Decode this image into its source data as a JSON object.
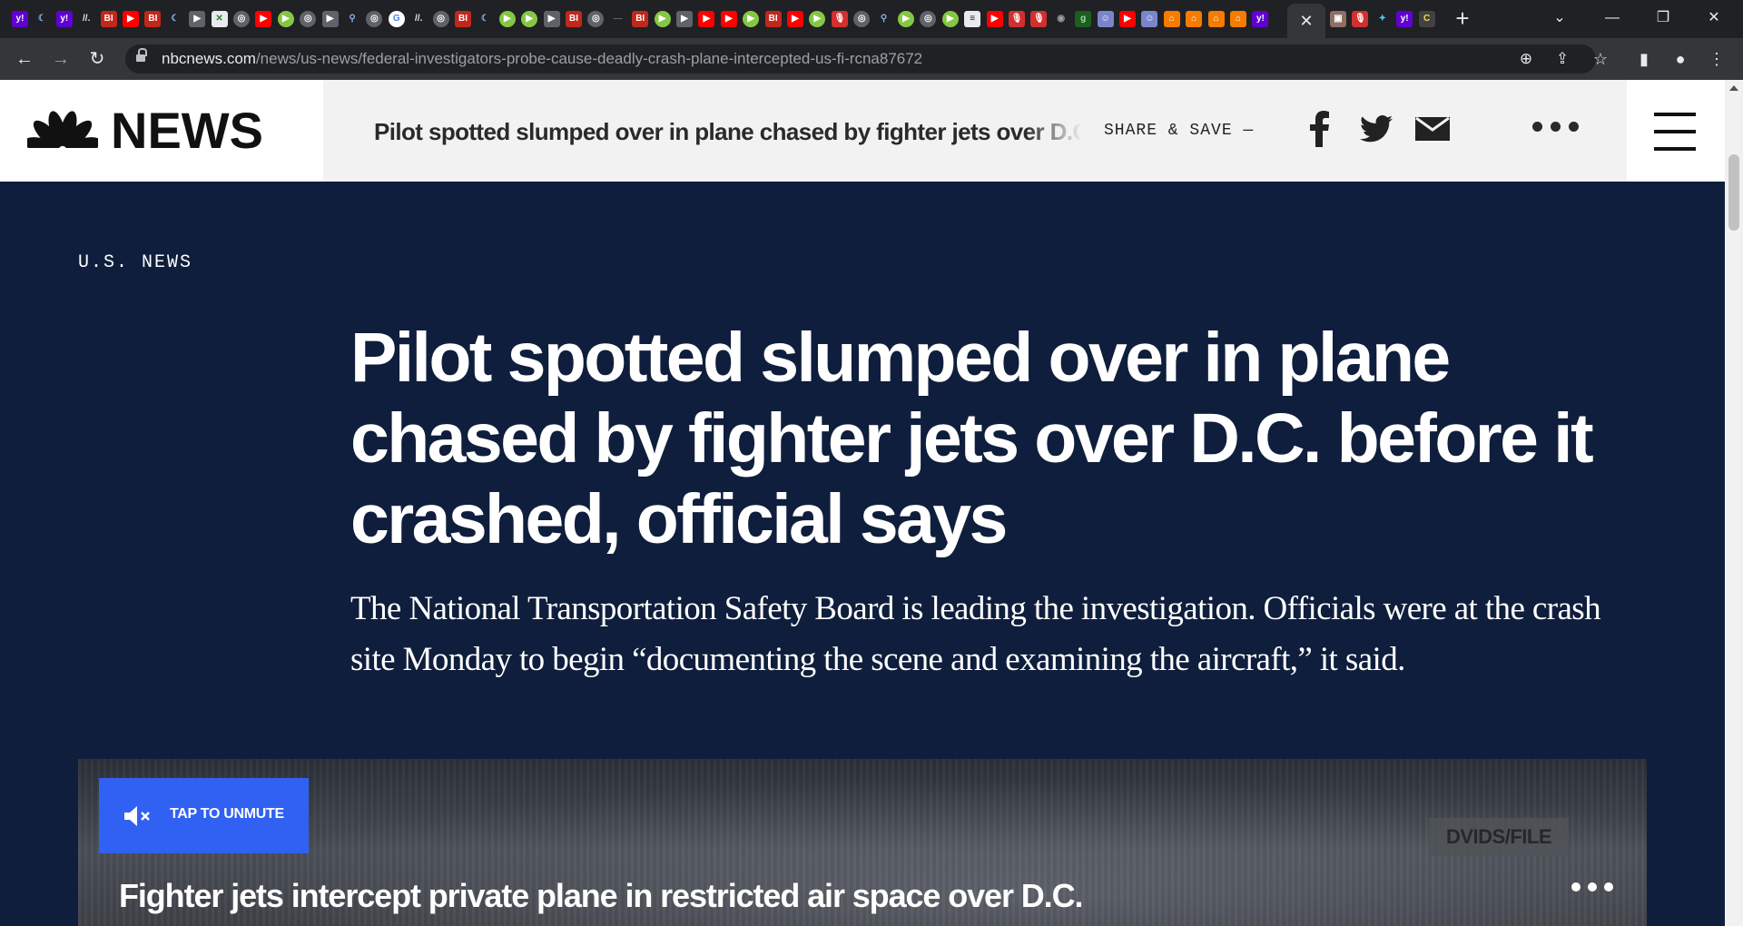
{
  "browser": {
    "favicons": [
      {
        "name": "yahoo-mail-icon",
        "bg": "#6001d2",
        "text": "y!"
      },
      {
        "name": "crescent-icon",
        "bg": "#202124",
        "text": "☾",
        "fg": "#8ab4f8"
      },
      {
        "name": "yahoo-mail-icon",
        "bg": "#6001d2",
        "text": "y!"
      },
      {
        "name": "slash-icon",
        "bg": "#202124",
        "text": "//.",
        "fg": "#e8eaed"
      },
      {
        "name": "business-insider-icon",
        "bg": "#c2271b",
        "text": "BI"
      },
      {
        "name": "youtube-icon",
        "bg": "#ff0000",
        "text": "▶"
      },
      {
        "name": "business-insider-icon",
        "bg": "#c2271b",
        "text": "BI"
      },
      {
        "name": "crescent-icon",
        "bg": "#202124",
        "text": "☾",
        "fg": "#8ab4f8"
      },
      {
        "name": "play-icon",
        "bg": "#5f6368",
        "text": "▶"
      },
      {
        "name": "puzzle-icon",
        "bg": "#e8eaed",
        "text": "✕",
        "fg": "#2e7d32"
      },
      {
        "name": "globe-icon",
        "bg": "#5f6368",
        "text": "◎",
        "circle": true
      },
      {
        "name": "youtube-icon",
        "bg": "#ff0000",
        "text": "▶"
      },
      {
        "name": "rumble-icon",
        "bg": "#85c742",
        "text": "▶",
        "circle": true
      },
      {
        "name": "globe-icon",
        "bg": "#5f6368",
        "text": "◎",
        "circle": true
      },
      {
        "name": "play-icon",
        "bg": "#5f6368",
        "text": "▶"
      },
      {
        "name": "search-icon",
        "bg": "#202124",
        "text": "⚲",
        "fg": "#8ab4f8"
      },
      {
        "name": "globe-icon",
        "bg": "#5f6368",
        "text": "◎",
        "circle": true
      },
      {
        "name": "google-icon",
        "bg": "#ffffff",
        "text": "G",
        "fg": "#4285f4",
        "circle": true
      },
      {
        "name": "slash-icon",
        "bg": "#202124",
        "text": "//.",
        "fg": "#e8eaed"
      },
      {
        "name": "globe-icon",
        "bg": "#5f6368",
        "text": "◎",
        "circle": true
      },
      {
        "name": "business-insider-icon",
        "bg": "#c2271b",
        "text": "BI"
      },
      {
        "name": "crescent-icon",
        "bg": "#202124",
        "text": "☾",
        "fg": "#8ab4f8"
      },
      {
        "name": "rumble-icon",
        "bg": "#85c742",
        "text": "▶",
        "circle": true
      },
      {
        "name": "rumble-icon",
        "bg": "#85c742",
        "text": "▶",
        "circle": true
      },
      {
        "name": "play-icon",
        "bg": "#5f6368",
        "text": "▶"
      },
      {
        "name": "business-insider-icon",
        "bg": "#c2271b",
        "text": "BI"
      },
      {
        "name": "globe-icon",
        "bg": "#5f6368",
        "text": "◎",
        "circle": true
      },
      {
        "name": "blank-icon",
        "bg": "#202124",
        "text": "—",
        "fg": "#5f6368"
      },
      {
        "name": "business-insider-icon",
        "bg": "#c2271b",
        "text": "BI"
      },
      {
        "name": "rumble-icon",
        "bg": "#85c742",
        "text": "▶",
        "circle": true
      },
      {
        "name": "play-icon",
        "bg": "#5f6368",
        "text": "▶"
      },
      {
        "name": "youtube-icon",
        "bg": "#ff0000",
        "text": "▶"
      },
      {
        "name": "youtube-icon",
        "bg": "#ff0000",
        "text": "▶"
      },
      {
        "name": "rumble-icon",
        "bg": "#85c742",
        "text": "▶",
        "circle": true
      },
      {
        "name": "business-insider-icon",
        "bg": "#c2271b",
        "text": "BI"
      },
      {
        "name": "youtube-icon",
        "bg": "#ff0000",
        "text": "▶"
      },
      {
        "name": "rumble-icon",
        "bg": "#85c742",
        "text": "▶",
        "circle": true
      },
      {
        "name": "podcast-icon",
        "bg": "#d32f2f",
        "text": "🎙"
      },
      {
        "name": "globe-icon",
        "bg": "#5f6368",
        "text": "◎",
        "circle": true
      },
      {
        "name": "search-icon",
        "bg": "#202124",
        "text": "⚲",
        "fg": "#8ab4f8"
      },
      {
        "name": "rumble-icon",
        "bg": "#85c742",
        "text": "▶",
        "circle": true
      },
      {
        "name": "globe-icon",
        "bg": "#5f6368",
        "text": "◎",
        "circle": true
      },
      {
        "name": "rumble-icon",
        "bg": "#85c742",
        "text": "▶",
        "circle": true
      },
      {
        "name": "news-icon",
        "bg": "#e8eaed",
        "text": "≡",
        "fg": "#202124"
      },
      {
        "name": "youtube-icon",
        "bg": "#ff0000",
        "text": "▶"
      },
      {
        "name": "podcast-icon",
        "bg": "#d32f2f",
        "text": "🎙"
      },
      {
        "name": "podcast-icon",
        "bg": "#d32f2f",
        "text": "🎙"
      },
      {
        "name": "circle-icon",
        "bg": "#202124",
        "text": "◉",
        "fg": "#9aa0a6"
      },
      {
        "name": "g-icon",
        "bg": "#1b5e20",
        "text": "g",
        "fg": "#a5d6a7"
      },
      {
        "name": "avatar-icon",
        "bg": "#7986cb",
        "text": "☺"
      },
      {
        "name": "youtube-icon",
        "bg": "#ff0000",
        "text": "▶"
      },
      {
        "name": "avatar-icon",
        "bg": "#7986cb",
        "text": "☺"
      },
      {
        "name": "bookmark-icon",
        "bg": "#f57c00",
        "text": "⌂"
      },
      {
        "name": "bookmark-icon",
        "bg": "#f57c00",
        "text": "⌂"
      },
      {
        "name": "bookmark-icon",
        "bg": "#f57c00",
        "text": "⌂"
      },
      {
        "name": "bookmark-icon",
        "bg": "#f57c00",
        "text": "⌂"
      },
      {
        "name": "yahoo-mail-icon",
        "bg": "#6001d2",
        "text": "y!"
      }
    ],
    "favicons_after": [
      {
        "name": "photo-icon",
        "bg": "#8d6e63",
        "text": "▣"
      },
      {
        "name": "podcast-icon",
        "bg": "#d32f2f",
        "text": "🎙"
      },
      {
        "name": "bird-icon",
        "bg": "#202124",
        "text": "✦",
        "fg": "#4fc3f7"
      },
      {
        "name": "yahoo-mail-icon",
        "bg": "#6001d2",
        "text": "y!"
      },
      {
        "name": "c-icon",
        "bg": "#424242",
        "text": "C",
        "fg": "#ffd54f"
      }
    ],
    "active_tab_close": "✕",
    "new_tab": "+",
    "tab_search": "⌄",
    "window_controls": {
      "minimize": "—",
      "restore": "❐",
      "close": "✕"
    },
    "nav": {
      "back": "←",
      "forward": "→",
      "reload": "↻"
    },
    "url_host": "nbcnews.com",
    "url_path": "/news/us-news/federal-investigators-probe-cause-deadly-crash-plane-intercepted-us-fi-rcna87672",
    "omnibox_icons": {
      "zoom": "⊕",
      "share": "⇪",
      "bookmark": "☆"
    },
    "toolbar_icons": {
      "sidepanel": "▮",
      "profile": "●",
      "menu": "⋮"
    }
  },
  "header": {
    "logo_text": "NEWS",
    "share_headline": "Pilot spotted slumped over in plane chased by fighter jets over D.C. before it crashed, official says",
    "share_label": "SHARE & SAVE —",
    "peacock_colors": [
      "#111111",
      "#111111",
      "#111111",
      "#111111",
      "#111111",
      "#111111"
    ]
  },
  "article": {
    "section": "U.S. NEWS",
    "headline": "Pilot spotted slumped over in plane chased by fighter jets over D.C. before it crashed, official says",
    "dek": "The National Transportation Safety Board is leading the investigation. Officials were at the crash site Monday to begin “documenting the scene and examining the aircraft,” it said."
  },
  "video": {
    "unmute_label": "TAP TO UNMUTE",
    "credit": "DVIDS/FILE",
    "title": "Fighter jets intercept private plane in restricted air space over D.C."
  },
  "colors": {
    "hero_bg": "#0f1e3c",
    "unmute_blue": "#3061f2"
  }
}
